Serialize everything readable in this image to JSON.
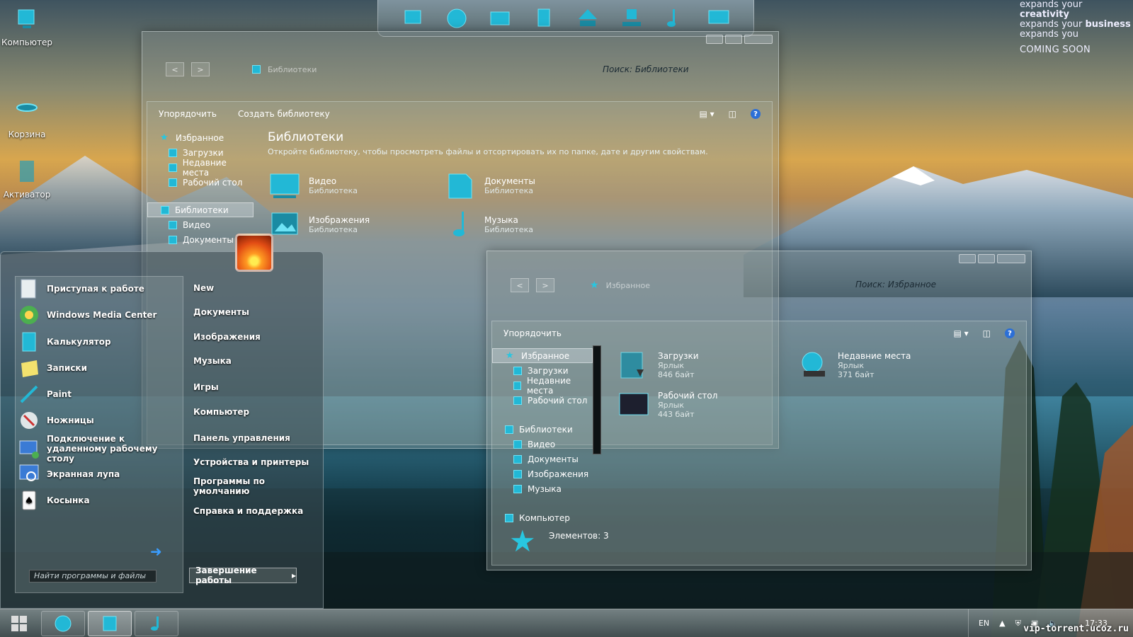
{
  "desktop": {
    "icons": [
      {
        "label": "Компьютер",
        "icon": "computer-icon"
      },
      {
        "label": "Корзина",
        "icon": "recycle-bin-icon"
      },
      {
        "label": "Активатор",
        "icon": "activator-icon"
      }
    ],
    "promo": {
      "line1_prefix": "expands your ",
      "line1_bold": "creativity",
      "line2_prefix": "expands your ",
      "line2_bold": "business",
      "line3": "expands you",
      "soon": "COMING SOON"
    }
  },
  "window_libraries": {
    "address": "Библиотеки",
    "search_placeholder": "Поиск: Библиотеки",
    "toolbar": {
      "organize": "Упорядочить",
      "create": "Создать библиотеку"
    },
    "nav": [
      {
        "label": "Избранное",
        "type": "header",
        "icon": "star-icon"
      },
      {
        "label": "Загрузки",
        "type": "sub",
        "icon": "downloads-icon"
      },
      {
        "label": "Недавние места",
        "type": "sub",
        "icon": "recent-places-icon"
      },
      {
        "label": "Рабочий стол",
        "type": "sub",
        "icon": "desktop-icon"
      },
      {
        "label": "Библиотеки",
        "type": "header-selected",
        "icon": "libraries-icon"
      },
      {
        "label": "Видео",
        "type": "sub",
        "icon": "video-icon"
      },
      {
        "label": "Документы",
        "type": "sub",
        "icon": "documents-icon"
      }
    ],
    "title": "Библиотеки",
    "description": "Откройте библиотеку, чтобы просмотреть файлы и отсортировать их по папке, дате и другим свойствам.",
    "tiles": [
      {
        "name": "Видео",
        "sub": "Библиотека",
        "icon": "video-library-icon"
      },
      {
        "name": "Документы",
        "sub": "Библиотека",
        "icon": "documents-library-icon"
      },
      {
        "name": "Изображения",
        "sub": "Библиотека",
        "icon": "images-library-icon"
      },
      {
        "name": "Музыка",
        "sub": "Библиотека",
        "icon": "music-library-icon"
      }
    ]
  },
  "window_favorites": {
    "address": "Избранное",
    "search_placeholder": "Поиск: Избранное",
    "toolbar": {
      "organize": "Упорядочить"
    },
    "nav": [
      {
        "label": "Избранное",
        "type": "header-selected",
        "icon": "star-icon"
      },
      {
        "label": "Загрузки",
        "type": "sub",
        "icon": "downloads-icon"
      },
      {
        "label": "Недавние места",
        "type": "sub",
        "icon": "recent-places-icon"
      },
      {
        "label": "Рабочий стол",
        "type": "sub",
        "icon": "desktop-icon"
      },
      {
        "label": "Библиотеки",
        "type": "header",
        "icon": "libraries-icon"
      },
      {
        "label": "Видео",
        "type": "sub",
        "icon": "video-icon"
      },
      {
        "label": "Документы",
        "type": "sub",
        "icon": "documents-icon"
      },
      {
        "label": "Изображения",
        "type": "sub",
        "icon": "images-icon"
      },
      {
        "label": "Музыка",
        "type": "sub",
        "icon": "music-icon"
      },
      {
        "label": "Компьютер",
        "type": "header",
        "icon": "computer-icon"
      }
    ],
    "items": [
      {
        "name": "Загрузки",
        "type": "Ярлык",
        "size": "846 байт",
        "icon": "downloads-shortcut-icon"
      },
      {
        "name": "Недавние места",
        "type": "Ярлык",
        "size": "371 байт",
        "icon": "recent-places-shortcut-icon"
      },
      {
        "name": "Рабочий стол",
        "type": "Ярлык",
        "size": "443 байт",
        "icon": "desktop-shortcut-icon"
      }
    ],
    "status": "Элементов: 3"
  },
  "start_menu": {
    "programs": [
      {
        "label": "Приступая к работе",
        "icon": "getting-started-icon"
      },
      {
        "label": "Windows Media Center",
        "icon": "media-center-icon"
      },
      {
        "label": "Калькулятор",
        "icon": "calculator-icon"
      },
      {
        "label": "Записки",
        "icon": "sticky-notes-icon"
      },
      {
        "label": "Paint",
        "icon": "paint-icon"
      },
      {
        "label": "Ножницы",
        "icon": "snipping-tool-icon"
      },
      {
        "label": "Подключение к удаленному рабочему столу",
        "icon": "remote-desktop-icon"
      },
      {
        "label": "Экранная лупа",
        "icon": "magnifier-icon"
      },
      {
        "label": "Косынка",
        "icon": "solitaire-icon"
      }
    ],
    "places": [
      "New",
      "Документы",
      "Изображения",
      "Музыка",
      "Игры",
      "Компьютер",
      "Панель управления",
      "Устройства и принтеры",
      "Программы по умолчанию",
      "Справка и поддержка"
    ],
    "search_placeholder": "Найти программы и файлы",
    "shutdown": "Завершение работы"
  },
  "taskbar": {
    "language": "EN",
    "time": "17:33"
  },
  "watermark": "vip-torrent.ucoz.ru",
  "colors": {
    "accent": "#22b8d6",
    "accent_light": "#6fe3f5"
  }
}
